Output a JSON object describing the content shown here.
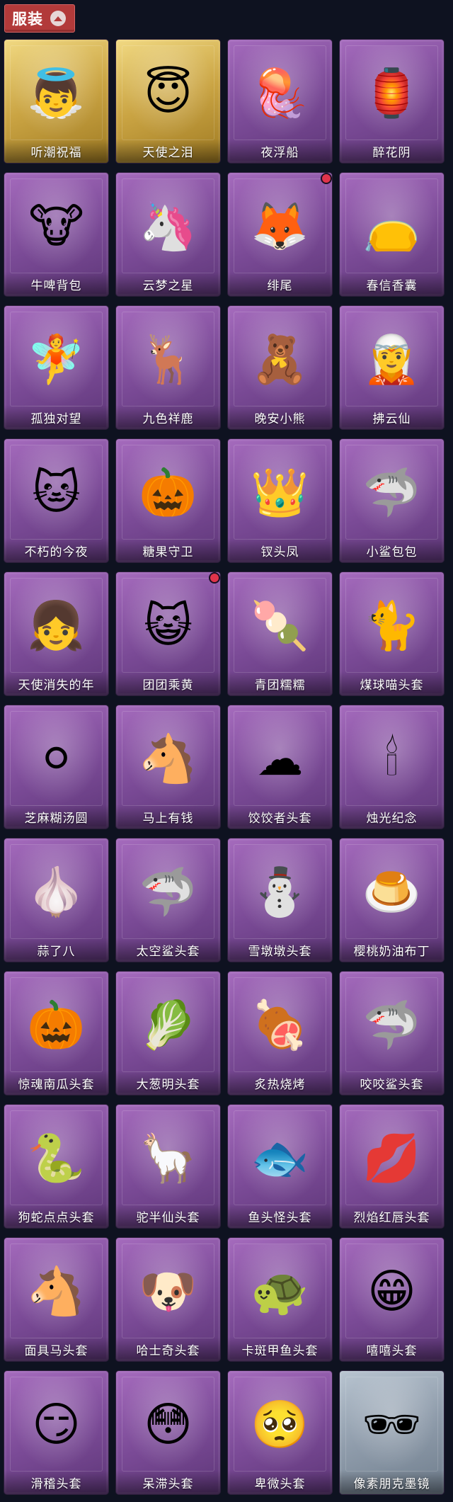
{
  "header": {
    "title": "服装",
    "caret_icon": "caret-up-icon"
  },
  "colors": {
    "header_bg": "#b23a3a",
    "card_purple": "#8a57a6",
    "card_gold": "#d8b55a",
    "card_silver": "#9aa7b4",
    "badge": "#e0344b"
  },
  "items": [
    {
      "label": "听潮祝福",
      "tier": "gold",
      "icon": "mannequin-wings-icon",
      "glyph": "👼",
      "badge": false
    },
    {
      "label": "天使之泪",
      "tier": "gold",
      "icon": "angel-halo-icon",
      "glyph": "😇",
      "badge": false
    },
    {
      "label": "夜浮船",
      "tier": "purple",
      "icon": "jellyfish-icon",
      "glyph": "🪼",
      "badge": false
    },
    {
      "label": "醉花阴",
      "tier": "purple",
      "icon": "flower-lantern-icon",
      "glyph": "🏮",
      "badge": false
    },
    {
      "label": "牛啤背包",
      "tier": "purple",
      "icon": "cow-barrel-backpack-icon",
      "glyph": "🐮",
      "badge": false
    },
    {
      "label": "云梦之星",
      "tier": "purple",
      "icon": "unicorn-cloud-icon",
      "glyph": "🦄",
      "badge": false
    },
    {
      "label": "绯尾",
      "tier": "purple",
      "icon": "fox-charm-icon",
      "glyph": "🦊",
      "badge": true
    },
    {
      "label": "春信香囊",
      "tier": "purple",
      "icon": "sachet-icon",
      "glyph": "👝",
      "badge": false
    },
    {
      "label": "孤独对望",
      "tier": "purple",
      "icon": "doll-charm-icon",
      "glyph": "🧚",
      "badge": false
    },
    {
      "label": "九色祥鹿",
      "tier": "purple",
      "icon": "deer-charm-icon",
      "glyph": "🦌",
      "badge": false
    },
    {
      "label": "晚安小熊",
      "tier": "purple",
      "icon": "bear-charm-icon",
      "glyph": "🧸",
      "badge": false
    },
    {
      "label": "拂云仙",
      "tier": "purple",
      "icon": "fairy-charm-icon",
      "glyph": "🧝",
      "badge": false
    },
    {
      "label": "不朽的今夜",
      "tier": "purple",
      "icon": "cat-cup-icon",
      "glyph": "🐱",
      "badge": false
    },
    {
      "label": "糖果守卫",
      "tier": "purple",
      "icon": "pumpkin-guard-icon",
      "glyph": "🎃",
      "badge": false
    },
    {
      "label": "钗头凤",
      "tier": "purple",
      "icon": "phoenix-crown-icon",
      "glyph": "👑",
      "badge": false
    },
    {
      "label": "小鲨包包",
      "tier": "purple",
      "icon": "shark-bag-icon",
      "glyph": "🦈",
      "badge": false
    },
    {
      "label": "天使消失的年",
      "tier": "purple",
      "icon": "angel-girl-icon",
      "glyph": "👧",
      "badge": false
    },
    {
      "label": "团团乘黄",
      "tier": "purple",
      "icon": "round-beast-head-icon",
      "glyph": "😺",
      "badge": true
    },
    {
      "label": "青团糯糯",
      "tier": "purple",
      "icon": "green-rice-ball-icon",
      "glyph": "🍡",
      "badge": false
    },
    {
      "label": "煤球喵头套",
      "tier": "purple",
      "icon": "black-cat-head-icon",
      "glyph": "🐈",
      "badge": false
    },
    {
      "label": "芝麻糊汤圆",
      "tier": "purple",
      "icon": "dumpling-head-icon",
      "glyph": "⚪",
      "badge": false
    },
    {
      "label": "马上有钱",
      "tier": "purple",
      "icon": "horse-head-icon",
      "glyph": "🐴",
      "badge": false
    },
    {
      "label": "饺饺者头套",
      "tier": "purple",
      "icon": "cloud-head-icon",
      "glyph": "☁",
      "badge": false
    },
    {
      "label": "烛光纪念",
      "tier": "purple",
      "icon": "candle-head-icon",
      "glyph": "🕯",
      "badge": false
    },
    {
      "label": "蒜了八",
      "tier": "purple",
      "icon": "garlic-head-icon",
      "glyph": "🧄",
      "badge": false
    },
    {
      "label": "太空鲨头套",
      "tier": "purple",
      "icon": "space-shark-head-icon",
      "glyph": "🦈",
      "badge": false
    },
    {
      "label": "雪墩墩头套",
      "tier": "purple",
      "icon": "snowman-head-icon",
      "glyph": "⛄",
      "badge": false
    },
    {
      "label": "樱桃奶油布丁",
      "tier": "purple",
      "icon": "pudding-head-icon",
      "glyph": "🍮",
      "badge": false
    },
    {
      "label": "惊魂南瓜头套",
      "tier": "purple",
      "icon": "jack-o-lantern-icon",
      "glyph": "🎃",
      "badge": false
    },
    {
      "label": "大葱明头套",
      "tier": "purple",
      "icon": "scallion-head-icon",
      "glyph": "🥬",
      "badge": false
    },
    {
      "label": "炙热烧烤",
      "tier": "purple",
      "icon": "bbq-head-icon",
      "glyph": "🍖",
      "badge": false
    },
    {
      "label": "咬咬鲨头套",
      "tier": "purple",
      "icon": "biting-shark-head-icon",
      "glyph": "🦈",
      "badge": false
    },
    {
      "label": "狗蛇点点头套",
      "tier": "purple",
      "icon": "dog-snake-head-icon",
      "glyph": "🐍",
      "badge": false
    },
    {
      "label": "驼半仙头套",
      "tier": "purple",
      "icon": "alpaca-sunglasses-head-icon",
      "glyph": "🦙",
      "badge": false
    },
    {
      "label": "鱼头怪头套",
      "tier": "purple",
      "icon": "fish-head-icon",
      "glyph": "🐟",
      "badge": false
    },
    {
      "label": "烈焰红唇头套",
      "tier": "purple",
      "icon": "red-lips-head-icon",
      "glyph": "💋",
      "badge": false
    },
    {
      "label": "面具马头套",
      "tier": "purple",
      "icon": "horse-mask-icon",
      "glyph": "🐴",
      "badge": false
    },
    {
      "label": "哈士奇头套",
      "tier": "purple",
      "icon": "husky-head-icon",
      "glyph": "🐶",
      "badge": false
    },
    {
      "label": "卡斑甲鱼头套",
      "tier": "purple",
      "icon": "turtle-head-icon",
      "glyph": "🐢",
      "badge": false
    },
    {
      "label": "嘻嘻头套",
      "tier": "purple",
      "icon": "grin-emoji-head-icon",
      "glyph": "😁",
      "badge": false
    },
    {
      "label": "滑稽头套",
      "tier": "purple",
      "icon": "smirk-emoji-head-icon",
      "glyph": "😏",
      "badge": false
    },
    {
      "label": "呆滞头套",
      "tier": "purple",
      "icon": "stare-emoji-head-icon",
      "glyph": "😳",
      "badge": false
    },
    {
      "label": "卑微头套",
      "tier": "purple",
      "icon": "humble-emoji-head-icon",
      "glyph": "🥺",
      "badge": false
    },
    {
      "label": "像素朋克墨镜",
      "tier": "silver",
      "icon": "pixel-sunglasses-icon",
      "glyph": "🕶",
      "badge": false
    }
  ]
}
